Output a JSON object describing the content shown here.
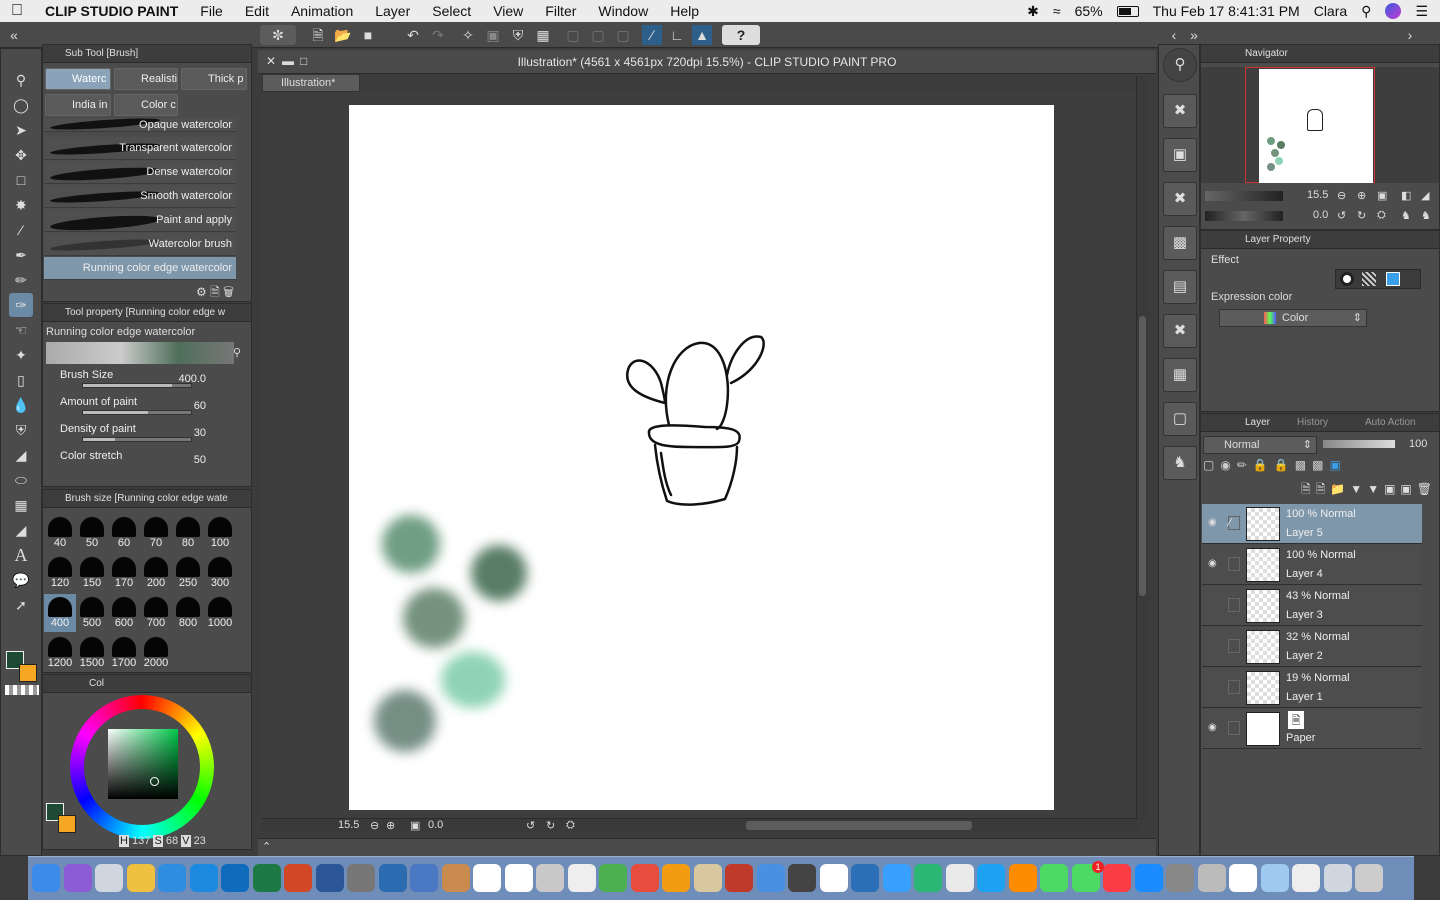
{
  "menubar": {
    "apple": "",
    "app": "CLIP STUDIO PAINT",
    "items": [
      "File",
      "Edit",
      "Animation",
      "Layer",
      "Select",
      "View",
      "Filter",
      "Window",
      "Help"
    ],
    "battery": "65%",
    "clock": "Thu Feb 17  8:41:31 PM",
    "user": "Clara"
  },
  "toolbar": {
    "help_label": "?"
  },
  "document": {
    "window_title": "Illustration* (4561 x 4561px 720dpi 15.5%)  - CLIP STUDIO PAINT PRO",
    "tab_label": "Illustration*",
    "zoom": "15.5",
    "angle": "0.0"
  },
  "subtool": {
    "header": "Sub Tool [Brush]",
    "tabs": [
      "Waterc",
      "Realisti",
      "Thick p",
      "India in",
      "Color c"
    ],
    "selected_tab": "Waterc",
    "brushes": [
      "Opaque watercolor",
      "Transparent watercolor",
      "Dense watercolor",
      "Smooth watercolor",
      "Paint and apply",
      "Watercolor brush",
      "Running color edge watercolor"
    ],
    "selected_brush": "Running color edge watercolor"
  },
  "tool_property": {
    "header": "Tool property [Running color edge w",
    "name": "Running color edge watercolor",
    "props": [
      {
        "label": "Brush Size",
        "value": "400.0",
        "level": 0.82
      },
      {
        "label": "Amount of paint",
        "value": "60",
        "level": 0.6
      },
      {
        "label": "Density of paint",
        "value": "30",
        "level": 0.3
      },
      {
        "label": "Color stretch",
        "value": "50",
        "level": 0.5
      }
    ]
  },
  "brush_size": {
    "header": "Brush size [Running color edge wate",
    "sizes": [
      "40",
      "50",
      "60",
      "70",
      "80",
      "100",
      "120",
      "150",
      "170",
      "200",
      "250",
      "300",
      "400",
      "500",
      "600",
      "700",
      "800",
      "1000",
      "1200",
      "1500",
      "1700",
      "2000"
    ],
    "selected": "400"
  },
  "color": {
    "tab_label": "Col",
    "hsv": {
      "h": "137",
      "s": "68",
      "v": "23"
    },
    "h_label": "H",
    "s_label": "S",
    "v_label": "V",
    "main_color": "#1e4a33",
    "sub_color": "#f5a623"
  },
  "navigator": {
    "header": "Navigator",
    "zoom": "15.5",
    "angle": "0.0"
  },
  "layer_property": {
    "header": "Layer Property",
    "effect_label": "Effect",
    "expression_label": "Expression color",
    "expression_value": "Color"
  },
  "layer_panel": {
    "tabs": [
      "Layer",
      "History",
      "Auto Action"
    ],
    "blend_mode": "Normal",
    "opacity": "100",
    "layers": [
      {
        "opacity_mode": "100 % Normal",
        "name": "Layer 5",
        "visible": true,
        "selected": true
      },
      {
        "opacity_mode": "100 % Normal",
        "name": "Layer 4",
        "visible": true,
        "selected": false
      },
      {
        "opacity_mode": "43 % Normal",
        "name": "Layer 3",
        "visible": false,
        "selected": false
      },
      {
        "opacity_mode": "32 % Normal",
        "name": "Layer 2",
        "visible": false,
        "selected": false
      },
      {
        "opacity_mode": "19 % Normal",
        "name": "Layer 1",
        "visible": false,
        "selected": false
      },
      {
        "opacity_mode": "",
        "name": "Paper",
        "visible": true,
        "selected": false
      }
    ]
  },
  "dock_badge": "1"
}
